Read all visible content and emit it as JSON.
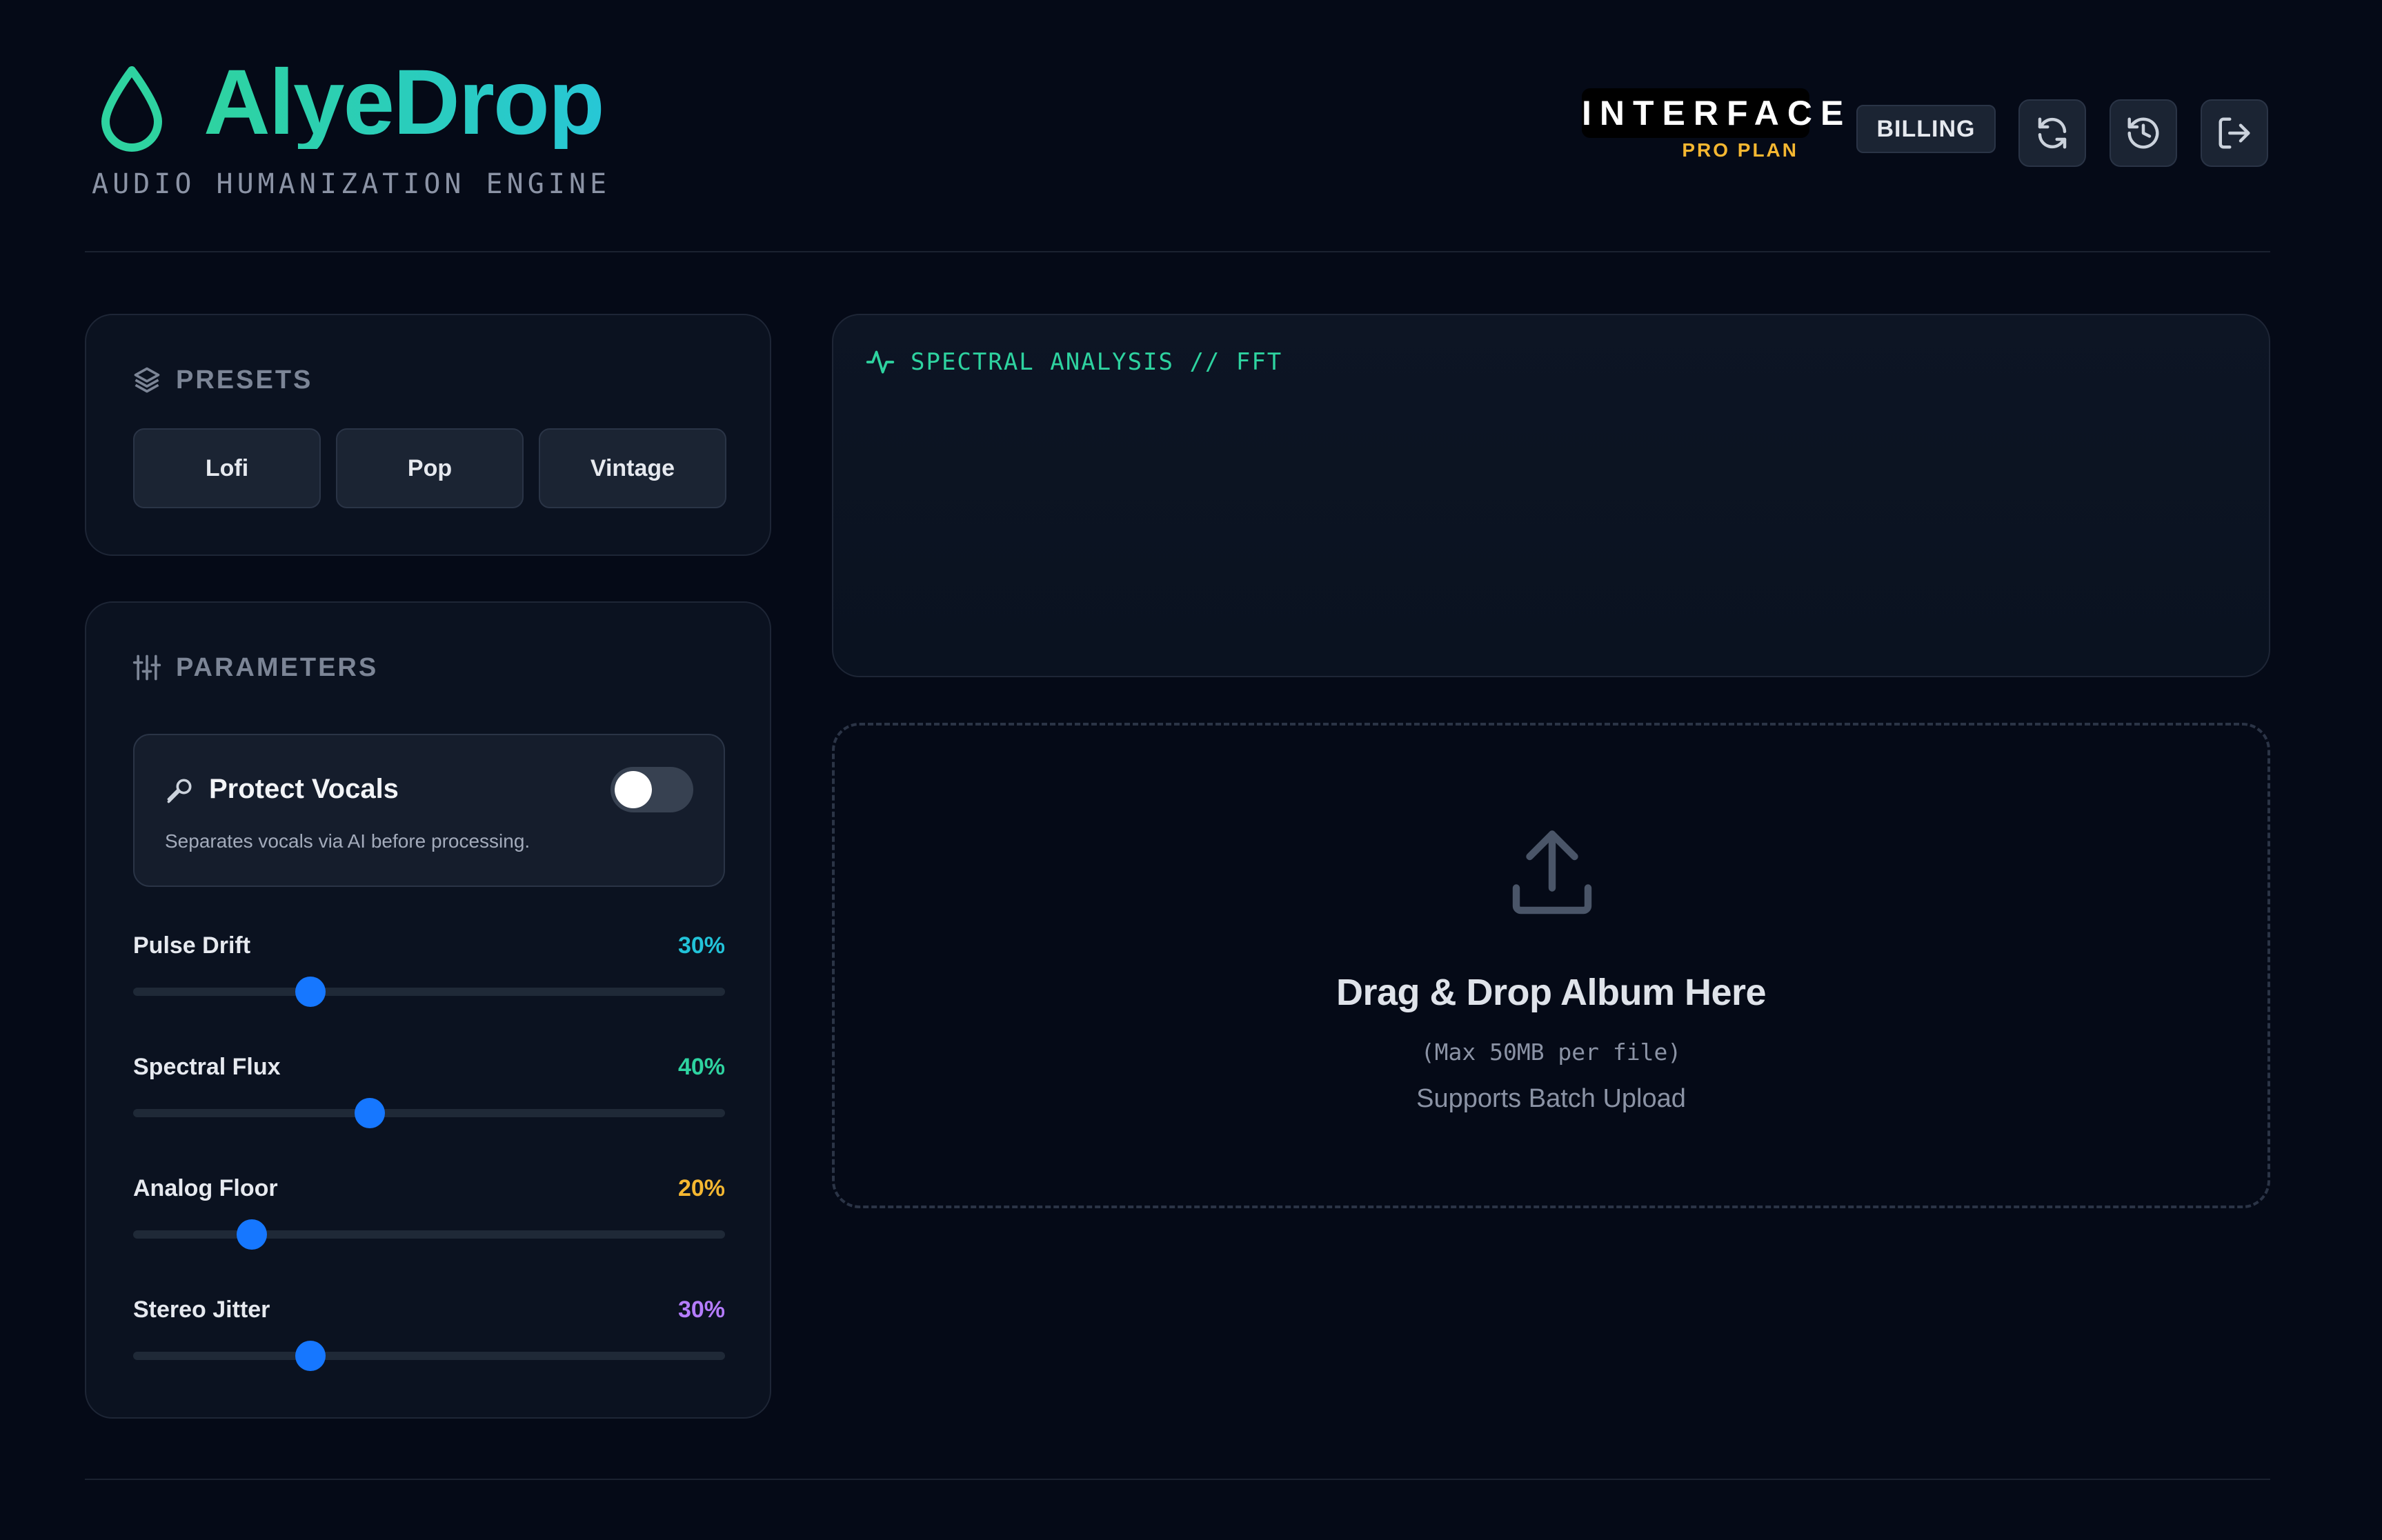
{
  "header": {
    "app_title": "AlyeDrop",
    "subtitle": "AUDIO HUMANIZATION ENGINE",
    "plan_name": "INTERFACE",
    "plan_tier": "PRO PLAN",
    "billing_label": "BILLING",
    "icons": [
      "refresh-icon",
      "history-icon",
      "logout-icon"
    ],
    "logo_icon": "droplet-icon"
  },
  "presets": {
    "heading": "PRESETS",
    "icon": "layers-icon",
    "items": [
      "Lofi",
      "Pop",
      "Vintage"
    ]
  },
  "parameters": {
    "heading": "PARAMETERS",
    "icon": "sliders-icon",
    "protect_vocals": {
      "title": "Protect Vocals",
      "description": "Separates vocals via AI before processing.",
      "icon": "microphone-icon",
      "enabled": false
    },
    "sliders": [
      {
        "label": "Pulse Drift",
        "value_text": "30%",
        "value": 0.3,
        "color": "#22c3d9"
      },
      {
        "label": "Spectral Flux",
        "value_text": "40%",
        "value": 0.4,
        "color": "#2ed3a0"
      },
      {
        "label": "Analog Floor",
        "value_text": "20%",
        "value": 0.2,
        "color": "#f5b731"
      },
      {
        "label": "Stereo Jitter",
        "value_text": "30%",
        "value": 0.3,
        "color": "#b57cff"
      }
    ]
  },
  "spectral": {
    "title": "SPECTRAL ANALYSIS // FFT",
    "icon": "activity-icon"
  },
  "dropzone": {
    "title": "Drag & Drop Album Here",
    "limit": "(Max 50MB per file)",
    "note": "Supports Batch Upload",
    "icon": "upload-icon"
  },
  "colors": {
    "background": "#050a17",
    "panel": "#0b1220",
    "accent_teal": "#2ed3a0",
    "accent_blue": "#1677ff",
    "plan_gold": "#f5b731"
  }
}
